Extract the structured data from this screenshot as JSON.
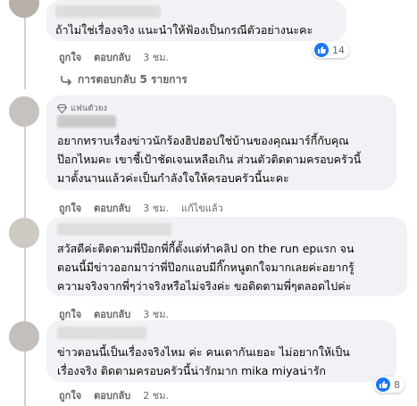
{
  "comments": [
    {
      "text": [
        "ถ้าไม่ใช่เรื่องจริง แนะนำให้ฟ้องเป็นกรณีตัวอย่างนะคะ"
      ],
      "like": "ถูกใจ",
      "reply": "ตอบกลับ",
      "time": "3 ชม.",
      "reaction_count": "14"
    },
    {
      "badge": "แฟนตัวยง",
      "text": [
        "อยากทราบเรื่องข่าวนักร้องฮิปฮอปใช่บ้านของคุณมาร์กี้กับคุณ",
        "ป๊อกไหมคะ เขาชี้เป้าชัดเจนเหลือเกิน ส่วนตัวติดตามครอบครัวนี้",
        "มาตั้งนานแล้วค่ะเป็นกำลังใจให้ครอบครัวนี้นะคะ"
      ],
      "like": "ถูกใจ",
      "reply": "ตอบกลับ",
      "time": "3 ชม.",
      "edited": "แก้ไขแล้ว"
    },
    {
      "text": [
        "สวัสดีค่ะติดตามพี่ป๊อกพี่กี้ตั้งแต่ทำคลิป on the run epแรก จน",
        "ตอนนี้มีข่าวออกมาว่าพี่ป๊อกแอบมีกิ๊กหนูตกใจมากเลยค่ะอยากรู้",
        "ความจริงจากพี่ๆว่าจริงหรือไม่จริงค่ะ ขอติดตามพี่ๆตลอดไปค่ะ"
      ],
      "like": "ถูกใจ",
      "reply": "ตอบกลับ",
      "time": "3 ชม."
    },
    {
      "text": [
        "ข่าวตอนนี้เป็นเรื่องจริงไหม ค่ะ คนเดากันเยอะ ไม่อยากให้เป็น",
        "เรื่องจริง ติดตามครอบครัวนี้น่ารักมาก mika miyaน่ารัก"
      ],
      "like": "ถูกใจ",
      "reply": "ตอบกลับ",
      "time": "2 ชม.",
      "reaction_count": "8"
    }
  ],
  "replies_link": "การตอบกลับ 5 รายการ",
  "colors": {
    "bubble": "#f0f2f5",
    "like_blue": "#1877f2",
    "meta_gray": "#65676b"
  },
  "icons": {
    "reaction": "thumbs-up-icon",
    "replies": "reply-arrow-icon",
    "badge": "diamond-icon"
  }
}
